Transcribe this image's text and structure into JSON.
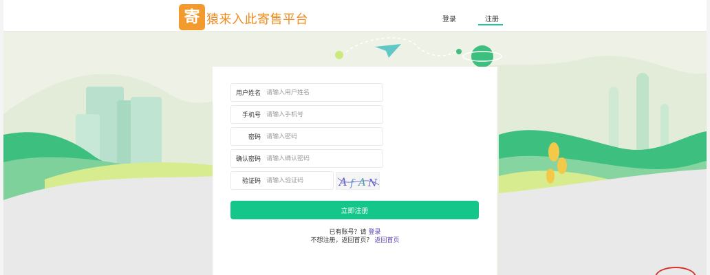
{
  "header": {
    "logo_glyph": "寄",
    "app_title": "猿来入此寄售平台",
    "nav_login": "登录",
    "nav_register": "注册"
  },
  "form": {
    "username": {
      "label": "用户姓名",
      "placeholder": "请输入用户姓名",
      "value": ""
    },
    "phone": {
      "label": "手机号",
      "placeholder": "请输入手机号",
      "value": ""
    },
    "password": {
      "label": "密码",
      "placeholder": "请输入密码",
      "value": ""
    },
    "confirm_password": {
      "label": "确认密码",
      "placeholder": "请输入确认密码",
      "value": ""
    },
    "captcha": {
      "label": "验证码",
      "placeholder": "请输入验证码",
      "value": "",
      "image_text": "AfAN"
    },
    "submit_label": "立即注册"
  },
  "footer_links": {
    "has_account": "已有账号？请",
    "login_link": "登录",
    "no_register": "不想注册，返回首页？",
    "home_link": "返回首页"
  },
  "colors": {
    "accent": "#14c68a",
    "brand_orange": "#f39a2e",
    "link_purple": "#5d3eb5"
  }
}
